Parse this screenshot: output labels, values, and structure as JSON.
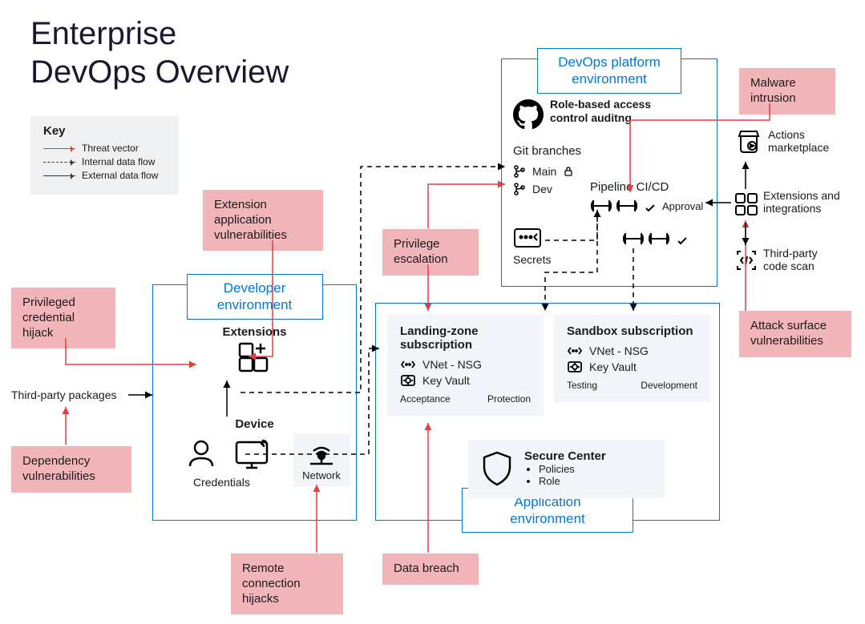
{
  "title_line1": "Enterprise",
  "title_line2": "DevOps Overview",
  "key": {
    "heading": "Key",
    "threat_vector": "Threat vector",
    "internal_flow": "Internal data flow",
    "external_flow": "External data flow"
  },
  "threats": {
    "privileged_credential_hijack": "Privileged credential hijack",
    "dependency_vulns": "Dependency vulnerabilities",
    "extension_app_vulns": "Extension application vulnerabilities",
    "remote_conn_hijacks": "Remote connection hijacks",
    "privilege_escalation": "Privilege escalation",
    "data_breach": "Data breach",
    "malware_intrusion": "Malware intrusion",
    "attack_surface_vulns": "Attack surface vulnerabilities"
  },
  "third_party_packages_label": "Third-party packages",
  "developer_env": {
    "title": "Developer environment",
    "extensions": "Extensions",
    "device": "Device",
    "credentials": "Credentials",
    "network": "Network"
  },
  "devops_env": {
    "title": "DevOps platform environment",
    "rbac_auditing": "Role-based access control auditng",
    "git_branches": "Git branches",
    "main_branch": "Main",
    "dev_branch": "Dev",
    "pipeline": "Pipeline CI/CD",
    "approval": "Approval",
    "secrets": "Secrets"
  },
  "right_side": {
    "actions_marketplace": "Actions marketplace",
    "extensions_integrations": "Extensions and integrations",
    "third_party_scan": "Third-party code scan"
  },
  "app_env": {
    "title": "Application environment",
    "landing_zone": {
      "heading": "Landing-zone subscription",
      "vnet": "VNet - NSG",
      "keyvault": "Key Vault",
      "acceptance": "Acceptance",
      "protection": "Protection"
    },
    "sandbox": {
      "heading": "Sandbox subscription",
      "vnet": "VNet - NSG",
      "keyvault": "Key Vault",
      "testing": "Testing",
      "development": "Development"
    },
    "secure_center": {
      "heading": "Secure Center",
      "policies": "Policies",
      "role": "Role"
    }
  }
}
